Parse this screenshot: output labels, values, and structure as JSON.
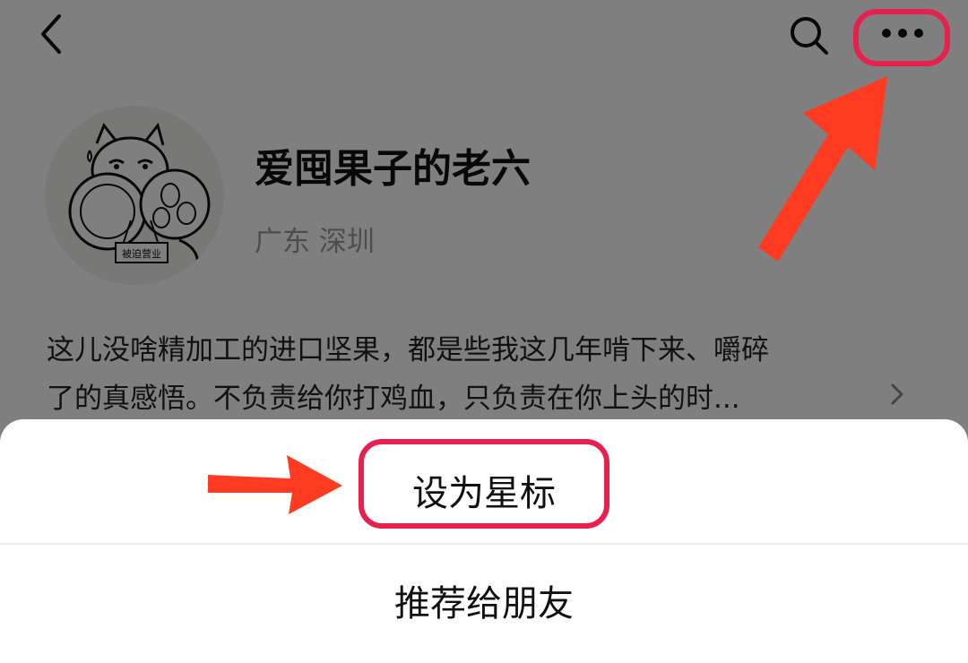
{
  "profile": {
    "name": "爱囤果子的老六",
    "location": "广东 深圳",
    "avatar_tag": "被迫营业",
    "bio_line1": "这儿没啥精加工的进口坚果，都是些我这几年啃下来、嚼碎",
    "bio_line2": "了的真感悟。不负责给你打鸡血，只负责在你上头的时..."
  },
  "toolbar": {
    "back_icon": "chevron-left-icon",
    "search_icon": "search-icon",
    "more_icon": "more-horizontal-icon"
  },
  "action_sheet": {
    "options": [
      "设为星标",
      "推荐给朋友"
    ]
  },
  "annotations": {
    "highlight_color": "#e8204e",
    "arrow_color": "#ff3b22"
  }
}
